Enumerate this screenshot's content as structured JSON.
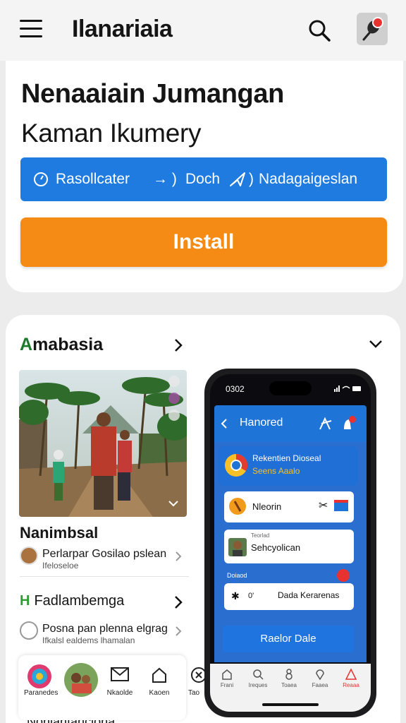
{
  "header": {
    "title": "Ilanariaia"
  },
  "hero": {
    "title": "Nenaaiain Jumangan",
    "subtitle": "Kaman Ikumery",
    "action_bar": {
      "item1": "Rasollcater",
      "item2": "Doch",
      "item3": "Nadagaigeslan"
    },
    "install_label": "Install"
  },
  "section": {
    "title_first": "A",
    "title_rest": "mabasia",
    "story_title": "Nanimbsal",
    "story_row": {
      "line1": "Perlarpar Gosilao pslean",
      "line2": "Ifeloseloe"
    },
    "sub_badge": "H",
    "sub_title": "Fadlambemga",
    "sub_row": {
      "line1": "Posna pan plenna elgrag",
      "line2": "Ifkalsl ealdems lhamalan"
    }
  },
  "bottom_nav": {
    "items": [
      {
        "label": "Paranedes"
      },
      {
        "label": ""
      },
      {
        "label": "Nkaolde"
      },
      {
        "label": "Kaoen"
      },
      {
        "label": "Tao"
      }
    ],
    "bottom_cut_text": "Nonlanfanclona"
  },
  "phone": {
    "status_time": "0302",
    "header_title": "Hanored",
    "title_card": {
      "line1": "Rekentien Dioseal",
      "line2": "Seens Aaalo"
    },
    "card1_text": "Nleorin",
    "card2_label": "Teorlad",
    "card2_text": "Sehcyolican",
    "section_label": "Doiaod",
    "card3_left": "0'",
    "card3_right": "Dada Kerarenas",
    "cta_label": "Raelor Dale",
    "nav": [
      "Frani",
      "Ireques",
      "Toaea",
      "Faaea",
      "Reaaa"
    ]
  },
  "colors": {
    "brand_blue": "#1f7be0",
    "install_orange": "#f58b14",
    "notification_red": "#e8322f",
    "section_green": "#1c7a2c"
  }
}
